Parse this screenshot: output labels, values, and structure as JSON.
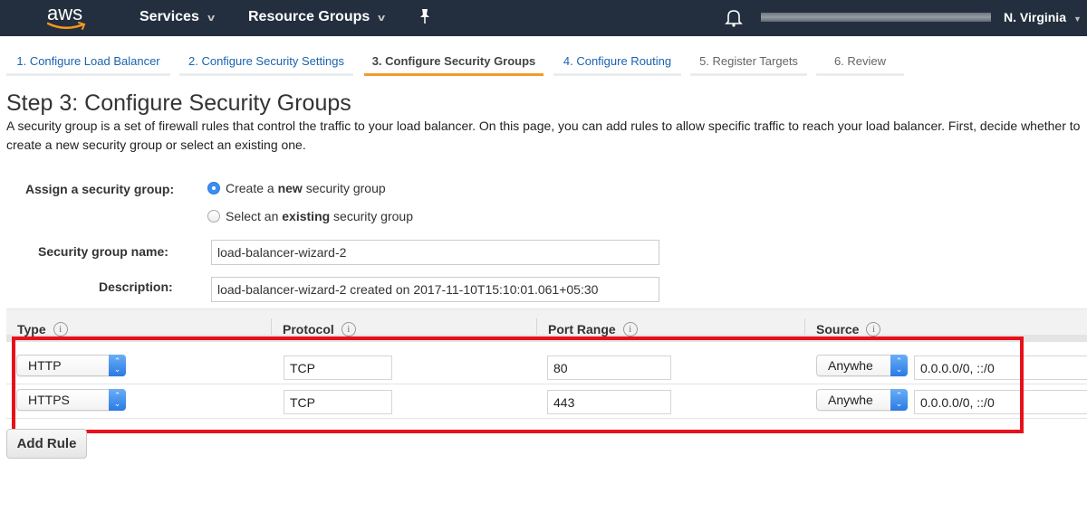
{
  "topnav": {
    "logo_text": "aws",
    "services_label": "Services",
    "resource_groups_label": "Resource Groups",
    "region_label": "N. Virginia"
  },
  "wizard": {
    "tabs": [
      {
        "label": "1. Configure Load Balancer",
        "state": "link"
      },
      {
        "label": "2. Configure Security Settings",
        "state": "link"
      },
      {
        "label": "3. Configure Security Groups",
        "state": "active"
      },
      {
        "label": "4. Configure Routing",
        "state": "link"
      },
      {
        "label": "5. Register Targets",
        "state": "disabled"
      },
      {
        "label": "6. Review",
        "state": "disabled"
      }
    ]
  },
  "page": {
    "title": "Step 3: Configure Security Groups",
    "intro_line1": "A security group is a set of firewall rules that control the traffic to your load balancer. On this page, you can add rules to allow specific traffic to reach your load balancer. First, decide whether to",
    "intro_line2": "create a new security group or select an existing one."
  },
  "form": {
    "assign_label": "Assign a security group:",
    "options": [
      {
        "prefix": "Create a ",
        "bold": "new",
        "suffix": " security group",
        "checked": true
      },
      {
        "prefix": "Select an ",
        "bold": "existing",
        "suffix": " security group",
        "checked": false
      }
    ],
    "name_label": "Security group name:",
    "name_value": "load-balancer-wizard-2",
    "description_label": "Description:",
    "description_value": "load-balancer-wizard-2 created on 2017-11-10T15:10:01.061+05:30"
  },
  "rules_table": {
    "columns": [
      "Type",
      "Protocol",
      "Port Range",
      "Source"
    ],
    "info_glyph": "i",
    "rows": [
      {
        "type": "HTTP",
        "protocol": "TCP",
        "port_range": "80",
        "source_select": "Anywhe",
        "source_cidr": "0.0.0.0/0, ::/0"
      },
      {
        "type": "HTTPS",
        "protocol": "TCP",
        "port_range": "443",
        "source_select": "Anywhe",
        "source_cidr": "0.0.0.0/0, ::/0"
      }
    ],
    "add_rule_label": "Add Rule"
  },
  "colors": {
    "nav_bg": "#232f3e",
    "link": "#1a63b0",
    "active_tab_underline": "#f29a2e",
    "highlight_border": "#e8101a",
    "select_accent": "#3b8ef3"
  },
  "icons": {
    "pin": "✦",
    "select_arrows": "⌃⌄"
  }
}
